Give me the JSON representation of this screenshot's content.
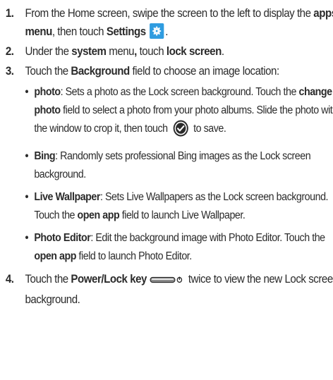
{
  "steps": [
    {
      "number": "1.",
      "p1": "From the Home screen, swipe the screen to the left to display the ",
      "b1": "apps menu",
      "p2": ", then touch ",
      "b2": "Settings",
      "p3": "."
    },
    {
      "number": "2.",
      "p1": "Under the ",
      "b1": "system",
      "p2": " menu",
      "p2b": ",",
      "p3": " touch ",
      "b2": "lock screen",
      "p4": "."
    },
    {
      "number": "3.",
      "p1": "Touch the ",
      "b1": "Background",
      "p2": " field to choose an image location:",
      "options": [
        {
          "name": "photo",
          "t1": ": Sets a photo as the Lock screen background. Touch the ",
          "b1": "change photo",
          "t2": " field to select a photo from your photo albums. Slide the photo within the window to crop it, then touch ",
          "t3": " to save."
        },
        {
          "name": "Bing",
          "t1": ": Randomly sets professional Bing images as the Lock screen background."
        },
        {
          "name": "Live Wallpaper",
          "t1": ": Sets Live Wallpapers as the Lock screen background. Touch the ",
          "b1": "open app",
          "t2": " field to launch Live Wallpaper."
        },
        {
          "name": "Photo Editor",
          "t1": ": Edit the background image with Photo Editor. Touch the ",
          "b1": "open app",
          "t2": " field to launch Photo Editor."
        }
      ]
    },
    {
      "number": "4.",
      "p1": "Touch the ",
      "b1": "Power/Lock key",
      "p2": " twice to view the new Lock screen background."
    }
  ],
  "bullet_char": "•",
  "icons": {
    "settings": "settings-gear-icon",
    "check": "checkmark-circle-icon",
    "power_key": "power-lock-key-icon"
  },
  "colors": {
    "text": "#2b2b2b",
    "settings_icon_bg": "#2f9ce0"
  }
}
